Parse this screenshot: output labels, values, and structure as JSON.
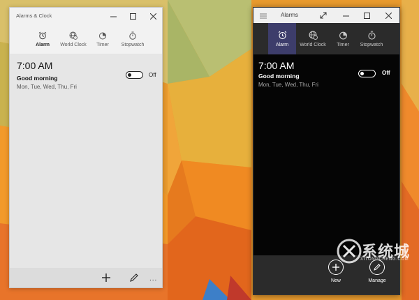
{
  "light_window": {
    "title": "Alarms & Clock",
    "tabs": [
      {
        "label": "Alarm",
        "icon": "alarm-clock-icon",
        "active": true
      },
      {
        "label": "World Clock",
        "icon": "globe-clock-icon",
        "active": false
      },
      {
        "label": "Timer",
        "icon": "timer-icon",
        "active": false
      },
      {
        "label": "Stopwatch",
        "icon": "stopwatch-icon",
        "active": false
      }
    ],
    "alarm": {
      "time": "7:00 AM",
      "name": "Good morning",
      "days": "Mon, Tue, Wed, Thu, Fri",
      "toggle_state": "Off"
    },
    "bottom_more": "..."
  },
  "dark_window": {
    "title": "Alarms",
    "tabs": [
      {
        "label": "Alarm",
        "icon": "alarm-clock-icon",
        "active": true
      },
      {
        "label": "World Clock",
        "icon": "globe-clock-icon",
        "active": false
      },
      {
        "label": "Timer",
        "icon": "timer-icon",
        "active": false
      },
      {
        "label": "Stopwatch",
        "icon": "stopwatch-icon",
        "active": false
      }
    ],
    "alarm": {
      "time": "7:00 AM",
      "name": "Good morning",
      "days": "Mon, Tue, Wed, Thu, Fri",
      "toggle_state": "Off"
    },
    "new_label": "New",
    "manage_label": "Manage"
  },
  "watermark": {
    "text": "系统城",
    "sub": "XITONGCHENG.COM"
  },
  "colors": {
    "dark_active_tab": "#3d3d6b",
    "dark_bg": "#050505",
    "light_bg": "#e6e6e6"
  }
}
